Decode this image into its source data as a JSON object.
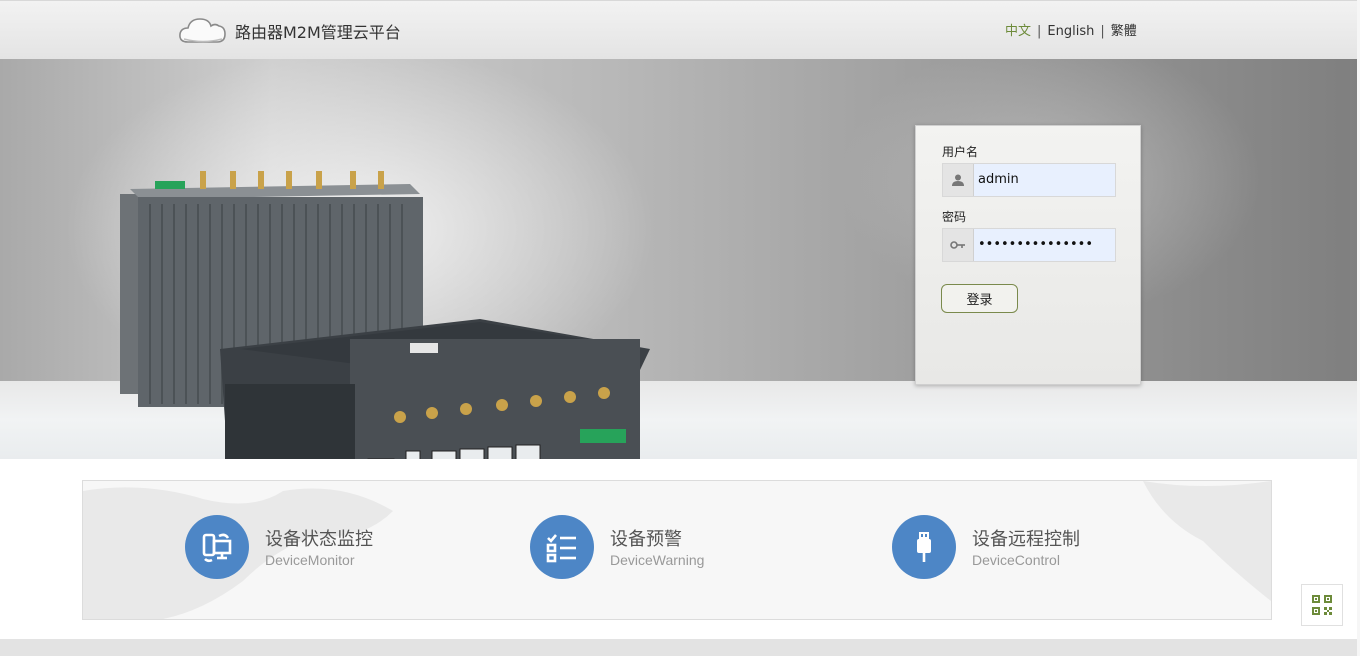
{
  "header": {
    "title": "路由器M2M管理云平台",
    "languages": [
      "中文",
      "English",
      "繁體"
    ],
    "active_language": "中文"
  },
  "login": {
    "username_label": "用户名",
    "username_value": "admin",
    "password_label": "密码",
    "password_value": "•••••••••••••••",
    "submit_label": "登录"
  },
  "features": [
    {
      "title": "设备状态监控",
      "subtitle": "DeviceMonitor",
      "icon": "device-monitor-icon"
    },
    {
      "title": "设备预警",
      "subtitle": "DeviceWarning",
      "icon": "checklist-icon"
    },
    {
      "title": "设备远程控制",
      "subtitle": "DeviceControl",
      "icon": "usb-icon"
    }
  ],
  "colors": {
    "accent": "#6d8b3a",
    "feature_circle": "#4d86c6"
  }
}
